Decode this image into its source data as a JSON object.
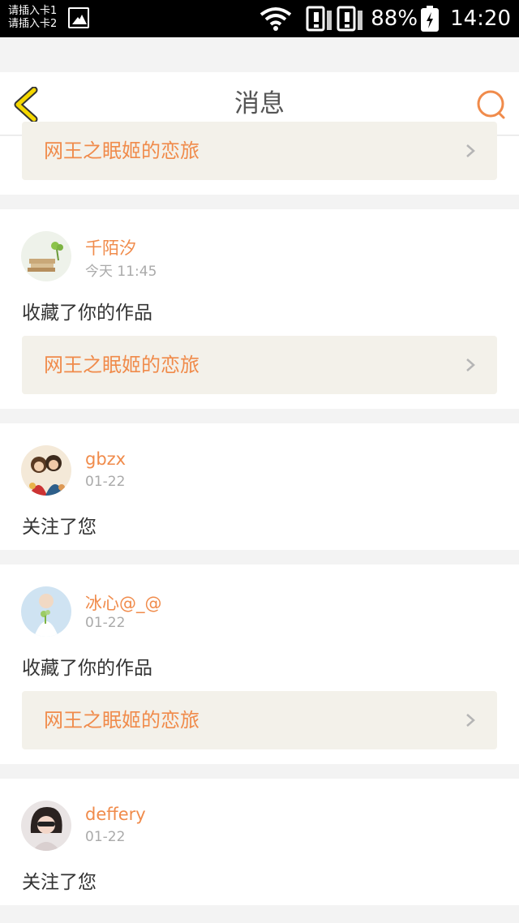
{
  "status_bar": {
    "sim1": "请插入卡1",
    "sim2": "请插入卡2",
    "battery": "88%",
    "time": "14:20",
    "icons": [
      "image-icon",
      "wifi-icon",
      "sim1-no-signal-icon",
      "sim2-no-signal-icon",
      "battery-icon"
    ]
  },
  "header": {
    "title": "消息",
    "back_icon": "chevron-left-icon",
    "search_icon": "search-icon"
  },
  "colors": {
    "accent": "#f08b4b",
    "back_icon": "#f5d800",
    "work_bar_bg": "#f3f1ea"
  },
  "messages": [
    {
      "work_title": "网王之眠姬的恋旅"
    },
    {
      "username": "千陌汐",
      "time": "今天 11:45",
      "action": "收藏了你的作品",
      "work_title": "网王之眠姬的恋旅"
    },
    {
      "username": "gbzx",
      "time": "01-22",
      "action": "关注了您"
    },
    {
      "username": "冰心@_@",
      "time": "01-22",
      "action": "收藏了你的作品",
      "work_title": "网王之眠姬的恋旅"
    },
    {
      "username": "deffery",
      "time": "01-22",
      "action": "关注了您"
    }
  ]
}
